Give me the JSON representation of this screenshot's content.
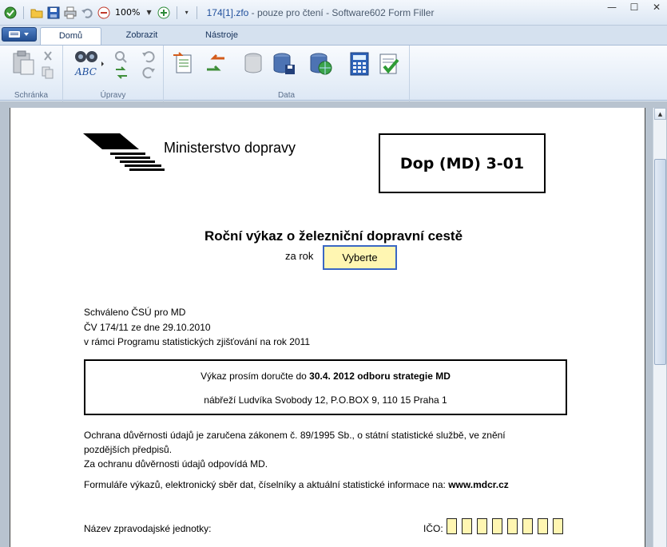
{
  "app": {
    "zoom": "100%",
    "file_name": "174[1].zfo",
    "title_rest": " -    pouze pro čtení - Software602 Form Filler"
  },
  "window_controls": {
    "minimize": "—",
    "maximize": "☐",
    "close": "✕"
  },
  "tabs": [
    {
      "label": "Domů",
      "active": true
    },
    {
      "label": "Zobrazit",
      "active": false
    },
    {
      "label": "Nástroje",
      "active": false
    }
  ],
  "ribbon": {
    "groups": [
      {
        "label": "Schránka"
      },
      {
        "label": "Úpravy"
      },
      {
        "label": "Data"
      }
    ],
    "abc_label": "ABC"
  },
  "document": {
    "ministry": "Ministerstvo dopravy",
    "form_code": "Dop (MD) 3-01",
    "title": "Roční výkaz o železniční dopravní cestě",
    "year_label": "za rok",
    "year_value": "Vyberte",
    "approval": [
      "Schváleno ČSÚ pro MD",
      "ČV 174/11 ze dne 29.10.2010",
      "v rámci Programu statistických zjišťování na rok 2011"
    ],
    "delivery_prefix": "Výkaz prosím doručte do ",
    "delivery_bold": "30.4. 2012  odboru strategie MD",
    "delivery_address": "nábřeží Ludvíka Svobody 12, P.O.BOX 9, 110 15 Praha 1",
    "confidentiality_1": "Ochrana důvěrnosti údajů je zaručena zákonem č. 89/1995 Sb., o státní statistické službě, ve znění",
    "confidentiality_2": "pozdějších předpisů.",
    "confidentiality_3": "Za ochranu důvěrnosti údajů odpovídá MD.",
    "forms_prefix": "Formuláře výkazů, elektronický sběr dat, číselníky a aktuální statistické informace na: ",
    "forms_url": "www.mdcr.cz",
    "unit_label": "Název zpravodajské jednotky:",
    "ico_label": "IČO:"
  },
  "colors": {
    "field_fill": "#fff6b2",
    "field_focus_border": "#3a67c4",
    "accent": "#1f4f9c"
  }
}
